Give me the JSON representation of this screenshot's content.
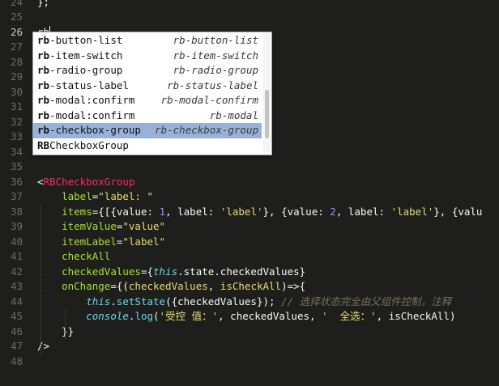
{
  "editor": {
    "line_numbers": [
      "24",
      "25",
      "26",
      "27",
      "28",
      "29",
      "30",
      "31",
      "32",
      "33",
      "34",
      "35",
      "36",
      "37",
      "38",
      "39",
      "40",
      "41",
      "42",
      "43",
      "44",
      "45",
      "46",
      "47",
      "48"
    ],
    "current_line": "26",
    "lines": [
      {
        "tokens": [
          {
            "t": "};",
            "c": "plain"
          }
        ]
      },
      {
        "tokens": []
      },
      {
        "tokens": [
          {
            "t": "rb",
            "c": "plain"
          }
        ],
        "cursor": true
      },
      {
        "tokens": []
      },
      {
        "tokens": []
      },
      {
        "tokens": []
      },
      {
        "tokens": []
      },
      {
        "tokens": []
      },
      {
        "tokens": []
      },
      {
        "tokens": []
      },
      {
        "tokens": []
      },
      {
        "tokens": []
      },
      {
        "tokens": [
          {
            "t": "<",
            "c": "plain"
          },
          {
            "t": "RBCheckboxGroup",
            "c": "tag"
          }
        ]
      },
      {
        "tokens": [
          {
            "t": "    "
          },
          {
            "t": "label",
            "c": "attr"
          },
          {
            "t": "=",
            "c": "plain"
          },
          {
            "t": "\"label: \"",
            "c": "str"
          }
        ]
      },
      {
        "tokens": [
          {
            "t": "    "
          },
          {
            "t": "items",
            "c": "attr"
          },
          {
            "t": "={[{value: ",
            "c": "plain"
          },
          {
            "t": "1",
            "c": "num"
          },
          {
            "t": ", label: ",
            "c": "plain"
          },
          {
            "t": "'label'",
            "c": "str"
          },
          {
            "t": "}, {value: ",
            "c": "plain"
          },
          {
            "t": "2",
            "c": "num"
          },
          {
            "t": ", label: ",
            "c": "plain"
          },
          {
            "t": "'label'",
            "c": "str"
          },
          {
            "t": "}, {valu",
            "c": "plain"
          }
        ]
      },
      {
        "tokens": [
          {
            "t": "    "
          },
          {
            "t": "itemValue",
            "c": "attr"
          },
          {
            "t": "=",
            "c": "plain"
          },
          {
            "t": "\"value\"",
            "c": "str"
          }
        ]
      },
      {
        "tokens": [
          {
            "t": "    "
          },
          {
            "t": "itemLabel",
            "c": "attr"
          },
          {
            "t": "=",
            "c": "plain"
          },
          {
            "t": "\"label\"",
            "c": "str"
          }
        ]
      },
      {
        "tokens": [
          {
            "t": "    "
          },
          {
            "t": "checkAll",
            "c": "attr"
          }
        ]
      },
      {
        "tokens": [
          {
            "t": "    "
          },
          {
            "t": "checkedValues",
            "c": "attr"
          },
          {
            "t": "={",
            "c": "plain"
          },
          {
            "t": "this",
            "c": "kw"
          },
          {
            "t": ".state.checkedValues}",
            "c": "plain"
          }
        ]
      },
      {
        "tokens": [
          {
            "t": "    "
          },
          {
            "t": "onChange",
            "c": "attr"
          },
          {
            "t": "={(",
            "c": "plain"
          },
          {
            "t": "checkedValues",
            "c": "str"
          },
          {
            "t": ", ",
            "c": "plain"
          },
          {
            "t": "isCheckAll",
            "c": "str"
          },
          {
            "t": ")=>{",
            "c": "plain"
          }
        ]
      },
      {
        "tokens": [
          {
            "t": "        "
          },
          {
            "t": "this",
            "c": "kw"
          },
          {
            "t": ".",
            "c": "plain"
          },
          {
            "t": "setState",
            "c": "fn"
          },
          {
            "t": "({checkedValues}); ",
            "c": "plain"
          },
          {
            "t": "// 选择状态完全由父组件控制，注释",
            "c": "cmt"
          }
        ]
      },
      {
        "tokens": [
          {
            "t": "        "
          },
          {
            "t": "console",
            "c": "kw"
          },
          {
            "t": ".",
            "c": "plain"
          },
          {
            "t": "log",
            "c": "fn"
          },
          {
            "t": "(",
            "c": "plain"
          },
          {
            "t": "'受控 值：'",
            "c": "str"
          },
          {
            "t": ", checkedValues, ",
            "c": "plain"
          },
          {
            "t": "'  全选：'",
            "c": "str"
          },
          {
            "t": ", isCheckAll)",
            "c": "plain"
          }
        ]
      },
      {
        "tokens": [
          {
            "t": "    }}",
            "c": "plain"
          }
        ]
      },
      {
        "tokens": [
          {
            "t": "/>",
            "c": "plain"
          }
        ]
      },
      {
        "tokens": []
      }
    ]
  },
  "autocomplete": {
    "typed_prefix": "rb",
    "items": [
      {
        "bold": "rb",
        "rest": "-button-list",
        "hint": "rb-button-list",
        "selected": false
      },
      {
        "bold": "rb",
        "rest": "-item-switch",
        "hint": "rb-item-switch",
        "selected": false
      },
      {
        "bold": "rb",
        "rest": "-radio-group",
        "hint": "rb-radio-group",
        "selected": false
      },
      {
        "bold": "rb",
        "rest": "-status-label",
        "hint": "rb-status-label",
        "selected": false
      },
      {
        "bold": "rb",
        "rest": "-modal:confirm",
        "hint": "rb-modal-confirm",
        "selected": false
      },
      {
        "bold": "rb",
        "rest": "-modal:confirm",
        "hint": "rb-modal",
        "selected": false
      },
      {
        "bold": "rb",
        "rest": "-checkbox-group",
        "hint": "rb-checkbox-group",
        "selected": true
      },
      {
        "bold": "RB",
        "rest": "CheckboxGroup",
        "hint": "",
        "selected": false
      }
    ]
  },
  "colors": {
    "background": "#1e1f1c",
    "tag": "#f92672",
    "attribute": "#a6e22e",
    "string": "#e6db74",
    "number": "#ae81ff",
    "keyword": "#66d9ef",
    "comment": "#75715e",
    "selection": "#98b1d8"
  }
}
